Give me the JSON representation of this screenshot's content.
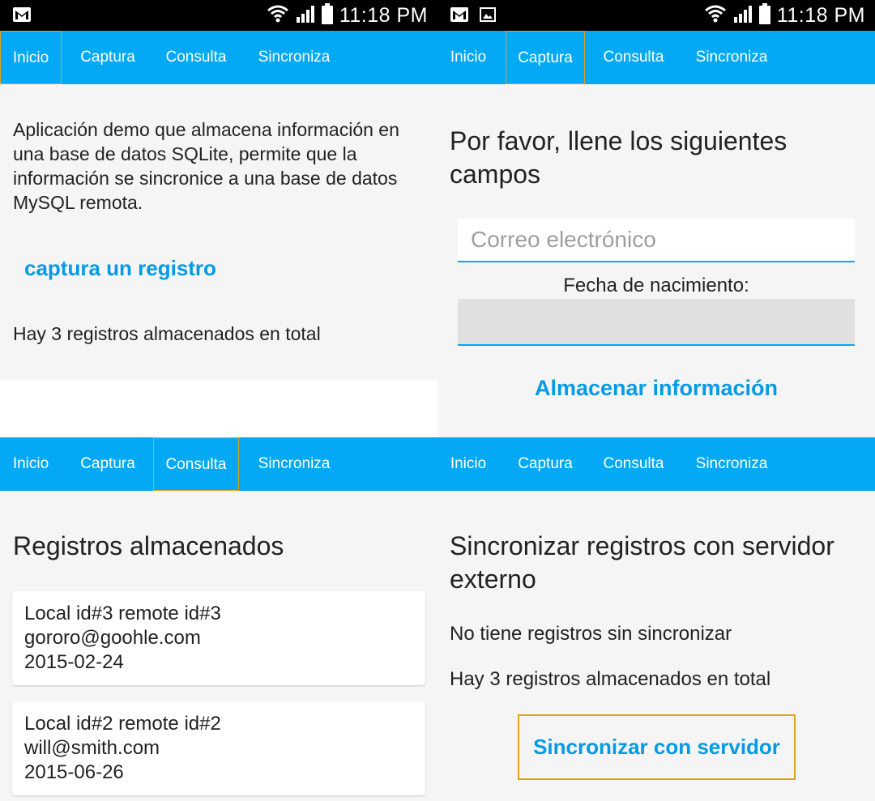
{
  "status_bar": {
    "time": "11:18 PM",
    "left_icons": [
      "gmail-icon"
    ],
    "left_icons_right_panel": [
      "gmail-icon",
      "image-icon"
    ],
    "right_icons": [
      "wifi-icon",
      "signal-icon",
      "battery-icon"
    ]
  },
  "tabs": [
    {
      "label": "Inicio"
    },
    {
      "label": "Captura"
    },
    {
      "label": "Consulta"
    },
    {
      "label": "Sincroniza"
    }
  ],
  "inicio": {
    "description": "Aplicación demo que almacena información en una base de datos SQLite, permite que la información se sincronice a una base de datos MySQL remota.",
    "link": "captura un registro",
    "count_text": "Hay 3 registros almacenados en total"
  },
  "captura": {
    "heading": "Por favor, llene los siguientes campos",
    "email_placeholder": "Correo electrónico",
    "email_value": "",
    "birthdate_label": "Fecha de nacimiento:",
    "birthdate_value": "",
    "save_label": "Almacenar información"
  },
  "consulta": {
    "heading": "Registros almacenados",
    "records": [
      {
        "ids": "Local id#3 remote id#3",
        "email": "gororo@goohle.com",
        "date": "2015-02-24"
      },
      {
        "ids": "Local id#2 remote id#2",
        "email": "will@smith.com",
        "date": "2015-06-26"
      }
    ]
  },
  "sincroniza": {
    "heading": "Sincronizar registros con servidor externo",
    "pending_text": "No tiene registros sin sincronizar",
    "count_text": "Hay 3 registros almacenados en total",
    "button_label": "Sincronizar con servidor"
  },
  "colors": {
    "accent": "#03a9f4",
    "link": "#039be5",
    "focus_border": "#e0a31c",
    "background": "#f5f5f5"
  }
}
